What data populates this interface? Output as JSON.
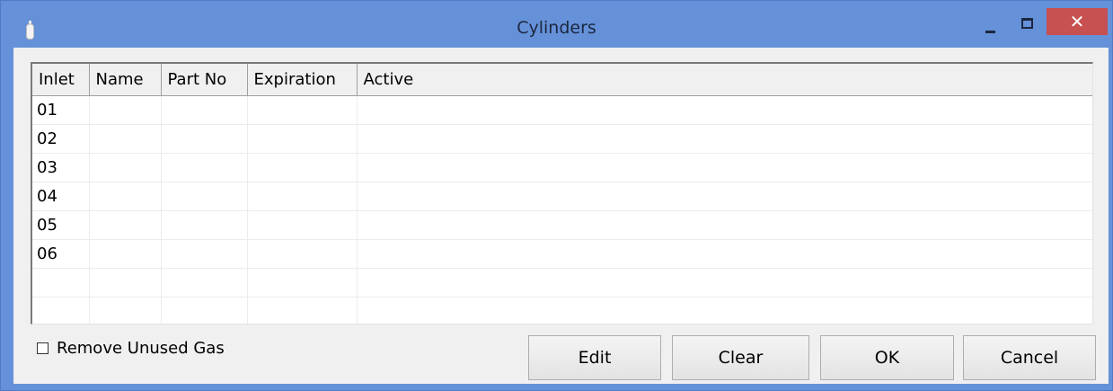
{
  "window": {
    "title": "Cylinders",
    "close_glyph": "✕",
    "colors": {
      "frame": "#6591d8",
      "close": "#c75050"
    }
  },
  "table": {
    "columns": [
      "Inlet",
      "Name",
      "Part No",
      "Expiration",
      "Active"
    ],
    "rows": [
      {
        "inlet": "01",
        "name": "",
        "part_no": "",
        "expiration": "",
        "active": ""
      },
      {
        "inlet": "02",
        "name": "",
        "part_no": "",
        "expiration": "",
        "active": ""
      },
      {
        "inlet": "03",
        "name": "",
        "part_no": "",
        "expiration": "",
        "active": ""
      },
      {
        "inlet": "04",
        "name": "",
        "part_no": "",
        "expiration": "",
        "active": ""
      },
      {
        "inlet": "05",
        "name": "",
        "part_no": "",
        "expiration": "",
        "active": ""
      },
      {
        "inlet": "06",
        "name": "",
        "part_no": "",
        "expiration": "",
        "active": ""
      }
    ]
  },
  "options": {
    "remove_unused_gas": {
      "label": "Remove Unused Gas",
      "checked": false
    }
  },
  "buttons": {
    "edit": "Edit",
    "clear": "Clear",
    "ok": "OK",
    "cancel": "Cancel"
  }
}
